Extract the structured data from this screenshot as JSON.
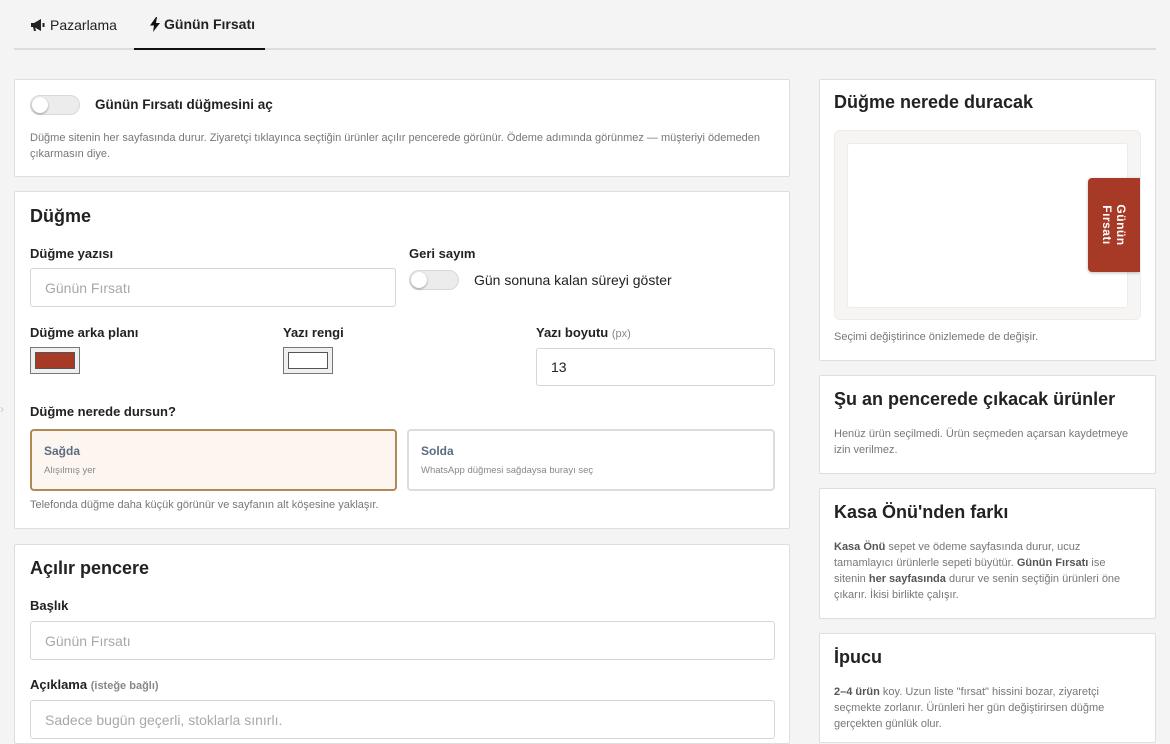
{
  "tabs": [
    {
      "label": "Pazarlama",
      "icon": "megaphone-icon"
    },
    {
      "label": "Günün Fırsatı",
      "icon": "lightning-icon",
      "active": true
    }
  ],
  "enable_card": {
    "toggle_label": "Günün Fırsatı düğmesini aç",
    "toggle_on": false,
    "description": "Düğme sitenin her sayfasında durur. Ziyaretçi tıklayınca seçtiğin ürünler açılır pencerede görünür. Ödeme adımında görünmez — müşteriyi ödemeden çıkarmasın diye."
  },
  "button_card": {
    "title": "Düğme",
    "text_label": "Düğme yazısı",
    "text_value": "",
    "text_placeholder": "Günün Fırsatı",
    "countdown_label": "Geri sayım",
    "countdown_toggle_label": "Gün sonuna kalan süreyi göster",
    "countdown_on": false,
    "bg_label": "Düğme arka planı",
    "bg_color": "#a63a27",
    "text_color_label": "Yazı rengi",
    "text_color": "#ffffff",
    "font_size_label": "Yazı boyutu",
    "font_size_unit": "(px)",
    "font_size_value": "13",
    "position_label": "Düğme nerede dursun?",
    "position_options": [
      {
        "title": "Sağda",
        "subtitle": "Alışılmış yer",
        "selected": true
      },
      {
        "title": "Solda",
        "subtitle": "WhatsApp düğmesi sağdaysa burayı seç",
        "selected": false
      }
    ],
    "position_help": "Telefonda düğme daha küçük görünür ve sayfanın alt köşesine yaklaşır."
  },
  "popup_card": {
    "title": "Açılır pencere",
    "heading_label": "Başlık",
    "heading_placeholder": "Günün Fırsatı",
    "desc_label": "Açıklama",
    "desc_optional": "(isteğe bağlı)",
    "desc_placeholder": "Sadece bugün geçerli, stoklarla sınırlı."
  },
  "preview_card": {
    "title": "Düğme nerede duracak",
    "preview_button_text": "Günün Fırsatı",
    "help": "Seçimi değiştirince önizlemede de değişir."
  },
  "products_card": {
    "title": "Şu an pencerede çıkacak ürünler",
    "text": "Henüz ürün seçilmedi. Ürün seçmeden açarsan kaydetmeye izin verilmez."
  },
  "diff_card": {
    "title": "Kasa Önü'nden farkı",
    "p1_bold": "Kasa Önü",
    "p2": " sepet ve ödeme sayfasında durur, ucuz tamamlayıcı ürünlerle sepeti büyütür. ",
    "p3_bold": "Günün Fırsatı",
    "p4": " ise sitenin ",
    "p5_bold": "her sayfasında",
    "p6": " durur ve senin seçtiğin ürünleri öne çıkarır. İkisi birlikte çalışır."
  },
  "tip_card": {
    "title": "İpucu",
    "p1_bold": "2–4 ürün",
    "p2": " koy. Uzun liste \"fırsat\" hissini bozar, ziyaretçi seçmekte zorlanır. Ürünleri her gün değiştirirsen düğme gerçekten günlük olur."
  },
  "colors": {
    "accent": "#a63a27",
    "selected_border": "#b08a55",
    "selected_bg": "#fdf5ef"
  }
}
